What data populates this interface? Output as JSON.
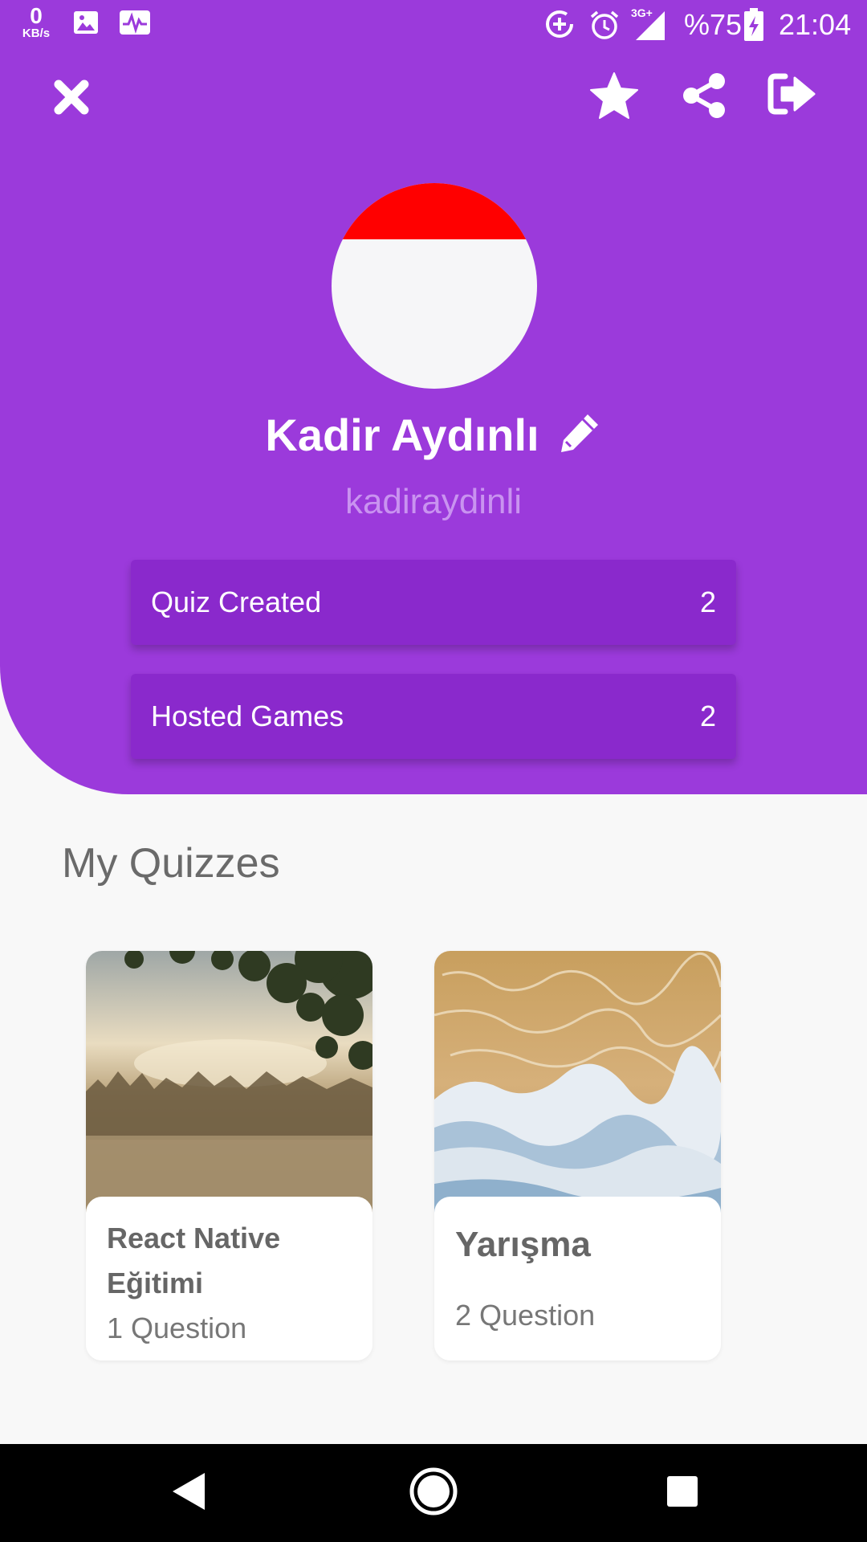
{
  "status_bar": {
    "speed_value": "0",
    "speed_unit": "KB/s",
    "network": "3G+",
    "battery": "%75",
    "time": "21:04",
    "left_icons": [
      "image-icon",
      "activity-icon"
    ],
    "right_icons": [
      "data-saver-icon",
      "alarm-icon",
      "signal-icon",
      "battery-charging-icon"
    ]
  },
  "toolbar": {
    "close_icon": "close-icon",
    "actions": [
      "star-icon",
      "share-icon",
      "logout-icon"
    ]
  },
  "profile": {
    "name": "Kadir Aydınlı",
    "username": "kadiraydinli",
    "edit_icon": "pencil-icon"
  },
  "stats": [
    {
      "label": "Quiz Created",
      "value": "2"
    },
    {
      "label": "Hosted Games",
      "value": "2"
    }
  ],
  "my_quizzes": {
    "title": "My Quizzes",
    "cards": [
      {
        "title": "React Native Eğitimi",
        "questions": "1 Question"
      },
      {
        "title": "Yarışma",
        "questions": "2 Question"
      }
    ]
  },
  "nav_bar": [
    "back-icon",
    "home-icon",
    "recents-icon"
  ],
  "colors": {
    "primary": "#9b3adb",
    "stat_bg": "#8a29cc",
    "flag_red": "#ff0000"
  }
}
